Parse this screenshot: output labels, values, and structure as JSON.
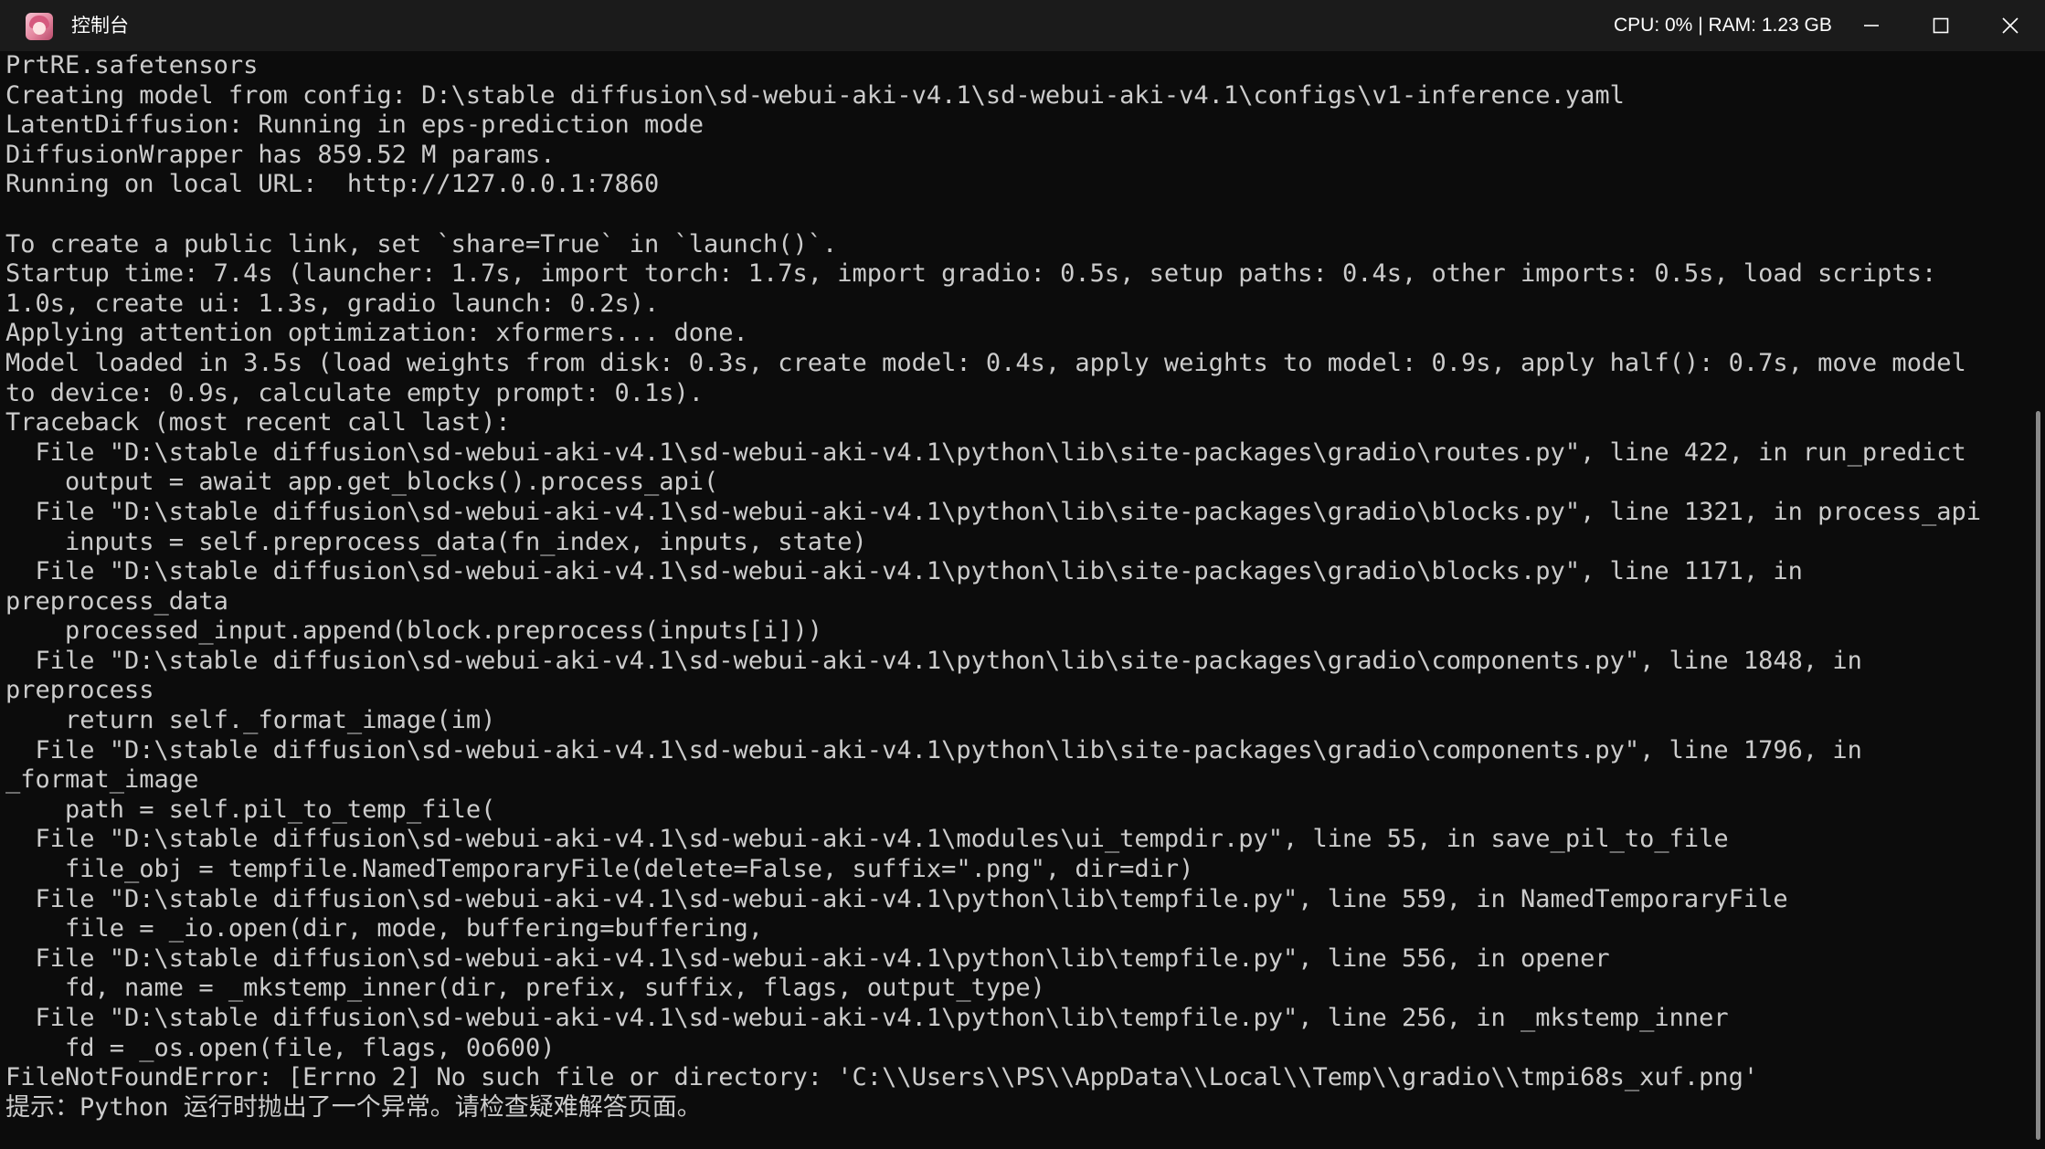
{
  "window": {
    "title": "控制台",
    "status": "CPU: 0% | RAM: 1.23 GB"
  },
  "icons": {
    "app": "anime-avatar-icon",
    "minimize": "minimize-icon",
    "maximize": "maximize-icon",
    "close": "close-icon"
  },
  "colors": {
    "terminal_bg": "#0c0c0c",
    "terminal_fg": "#cccccc",
    "titlebar_bg": "#1b1b1b"
  },
  "console": {
    "lines": [
      "PrtRE.safetensors",
      "Creating model from config: D:\\stable diffusion\\sd-webui-aki-v4.1\\sd-webui-aki-v4.1\\configs\\v1-inference.yaml",
      "LatentDiffusion: Running in eps-prediction mode",
      "DiffusionWrapper has 859.52 M params.",
      "Running on local URL:  http://127.0.0.1:7860",
      "",
      "To create a public link, set `share=True` in `launch()`.",
      "Startup time: 7.4s (launcher: 1.7s, import torch: 1.7s, import gradio: 0.5s, setup paths: 0.4s, other imports: 0.5s, load scripts:",
      "1.0s, create ui: 1.3s, gradio launch: 0.2s).",
      "Applying attention optimization: xformers... done.",
      "Model loaded in 3.5s (load weights from disk: 0.3s, create model: 0.4s, apply weights to model: 0.9s, apply half(): 0.7s, move model",
      "to device: 0.9s, calculate empty prompt: 0.1s).",
      "Traceback (most recent call last):",
      "  File \"D:\\stable diffusion\\sd-webui-aki-v4.1\\sd-webui-aki-v4.1\\python\\lib\\site-packages\\gradio\\routes.py\", line 422, in run_predict",
      "    output = await app.get_blocks().process_api(",
      "  File \"D:\\stable diffusion\\sd-webui-aki-v4.1\\sd-webui-aki-v4.1\\python\\lib\\site-packages\\gradio\\blocks.py\", line 1321, in process_api",
      "    inputs = self.preprocess_data(fn_index, inputs, state)",
      "  File \"D:\\stable diffusion\\sd-webui-aki-v4.1\\sd-webui-aki-v4.1\\python\\lib\\site-packages\\gradio\\blocks.py\", line 1171, in",
      "preprocess_data",
      "    processed_input.append(block.preprocess(inputs[i]))",
      "  File \"D:\\stable diffusion\\sd-webui-aki-v4.1\\sd-webui-aki-v4.1\\python\\lib\\site-packages\\gradio\\components.py\", line 1848, in",
      "preprocess",
      "    return self._format_image(im)",
      "  File \"D:\\stable diffusion\\sd-webui-aki-v4.1\\sd-webui-aki-v4.1\\python\\lib\\site-packages\\gradio\\components.py\", line 1796, in",
      "_format_image",
      "    path = self.pil_to_temp_file(",
      "  File \"D:\\stable diffusion\\sd-webui-aki-v4.1\\sd-webui-aki-v4.1\\modules\\ui_tempdir.py\", line 55, in save_pil_to_file",
      "    file_obj = tempfile.NamedTemporaryFile(delete=False, suffix=\".png\", dir=dir)",
      "  File \"D:\\stable diffusion\\sd-webui-aki-v4.1\\sd-webui-aki-v4.1\\python\\lib\\tempfile.py\", line 559, in NamedTemporaryFile",
      "    file = _io.open(dir, mode, buffering=buffering,",
      "  File \"D:\\stable diffusion\\sd-webui-aki-v4.1\\sd-webui-aki-v4.1\\python\\lib\\tempfile.py\", line 556, in opener",
      "    fd, name = _mkstemp_inner(dir, prefix, suffix, flags, output_type)",
      "  File \"D:\\stable diffusion\\sd-webui-aki-v4.1\\sd-webui-aki-v4.1\\python\\lib\\tempfile.py\", line 256, in _mkstemp_inner",
      "    fd = _os.open(file, flags, 0o600)",
      "FileNotFoundError: [Errno 2] No such file or directory: 'C:\\\\Users\\\\PS\\\\AppData\\\\Local\\\\Temp\\\\gradio\\\\tmpi68s_xuf.png'",
      "提示：Python 运行时抛出了一个异常。请检查疑难解答页面。"
    ]
  }
}
